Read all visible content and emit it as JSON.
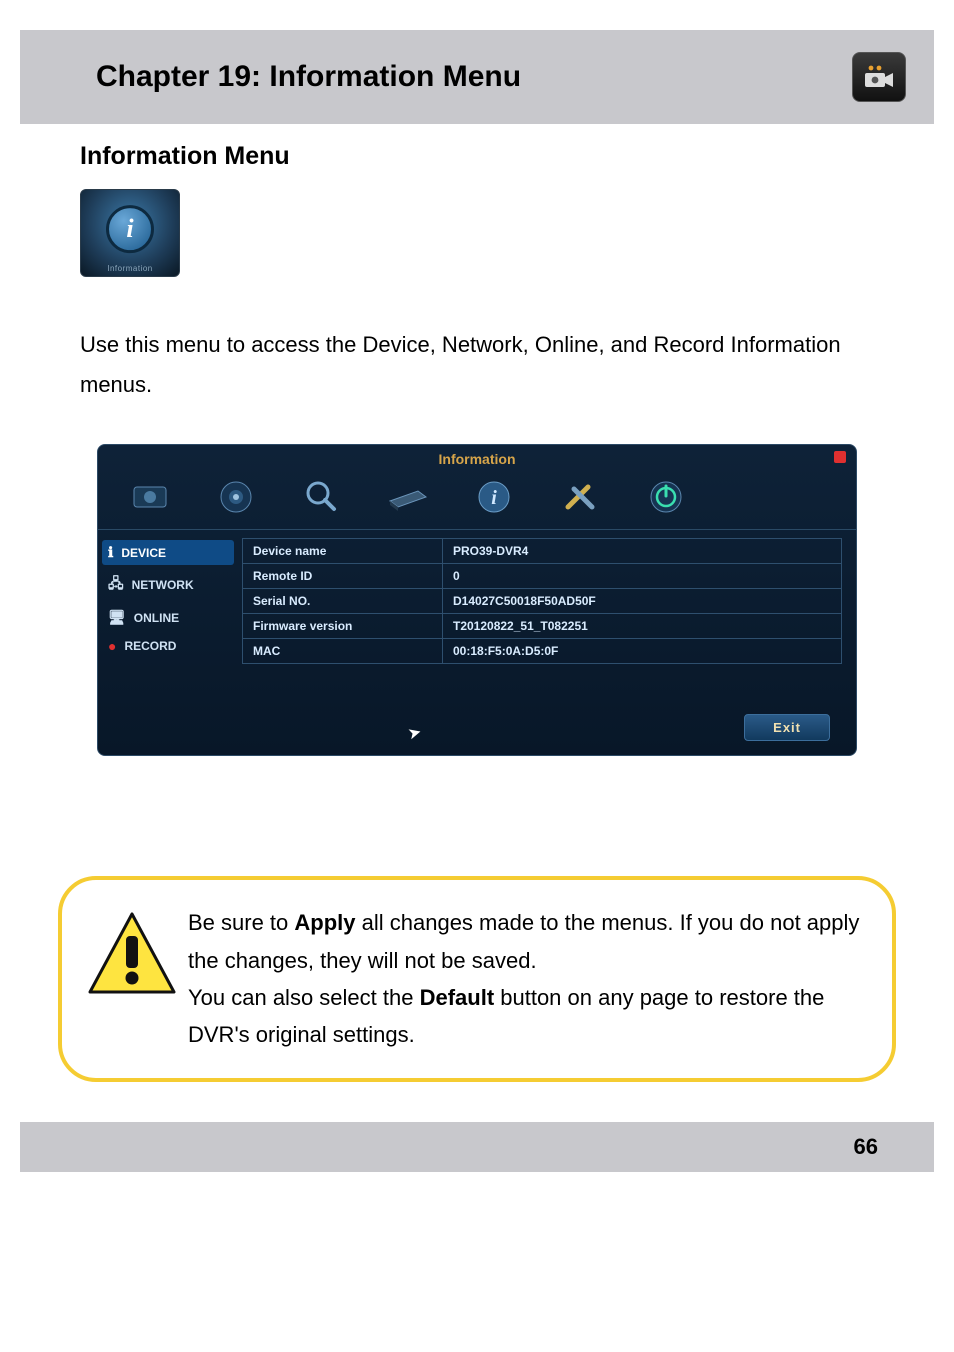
{
  "header": {
    "chapter_title": "Chapter 19: Information Menu"
  },
  "section": {
    "title": "Information Menu",
    "thumb_letter": "i",
    "thumb_caption": "Information",
    "intro_text": "Use this menu to access the Device, Network, Online, and Record Information menus."
  },
  "screenshot": {
    "window_title": "Information",
    "sidebar": [
      {
        "label": "DEVICE",
        "icon": "ℹ",
        "active": true
      },
      {
        "label": "NETWORK",
        "icon": "🖧",
        "active": false
      },
      {
        "label": "ONLINE",
        "icon": "🖥",
        "active": false
      },
      {
        "label": "RECORD",
        "icon": "●",
        "active": false
      }
    ],
    "rows": [
      {
        "key": "Device name",
        "value": "PRO39-DVR4"
      },
      {
        "key": "Remote ID",
        "value": "0"
      },
      {
        "key": "Serial NO.",
        "value": "D14027C50018F50AD50F"
      },
      {
        "key": "Firmware version",
        "value": "T20120822_51_T082251"
      },
      {
        "key": "MAC",
        "value": "00:18:F5:0A:D5:0F"
      }
    ],
    "exit_label": "Exit"
  },
  "note": {
    "line1_pre": "Be sure to ",
    "line1_bold": "Apply",
    "line1_post": " all changes made to the menus. If you do not apply the changes, they will not be saved.",
    "line2_pre": "You can also select the ",
    "line2_bold": "Default",
    "line2_post": " button on any page to restore the DVR's original settings."
  },
  "page_number": "66"
}
